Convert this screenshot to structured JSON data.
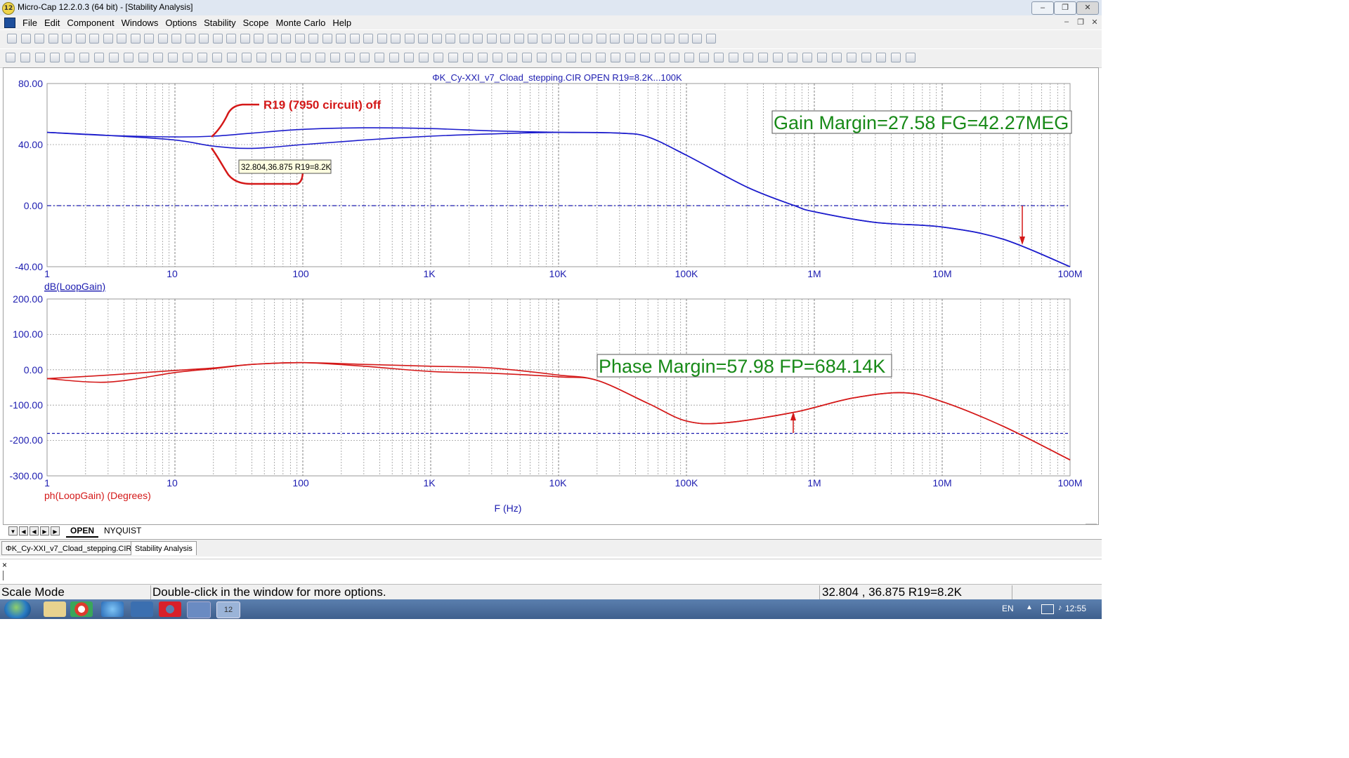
{
  "window": {
    "title": "Micro-Cap 12.2.0.3 (64 bit) - [Stability Analysis]",
    "app_icon": "12"
  },
  "menu": [
    "File",
    "Edit",
    "Component",
    "Windows",
    "Options",
    "Stability",
    "Scope",
    "Monte Carlo",
    "Help"
  ],
  "plot": {
    "title": "ΦK_Cy-XXI_v7_Cload_stepping.CIR OPEN R19=8.2K...100K",
    "xlabel": "F (Hz)",
    "x_ticks": [
      "1",
      "10",
      "100",
      "1K",
      "10K",
      "100K",
      "1M",
      "10M",
      "100M"
    ],
    "top": {
      "ylabel": "dB(LoopGain)",
      "y_ticks": [
        "80.00",
        "40.00",
        "0.00",
        "-40.00"
      ],
      "annotation": "Gain Margin=27.58 FG=42.27MEG",
      "handwritten": "R19 (7950 circuit) off",
      "tooltip": "32.804,36.875 R19=8.2K"
    },
    "bottom": {
      "ylabel": "ph(LoopGain) (Degrees)",
      "y_ticks": [
        "200.00",
        "100.00",
        "0.00",
        "-100.00",
        "-200.00",
        "-300.00"
      ],
      "annotation": "Phase Margin=57.98 FP=684.14K"
    }
  },
  "chart_data": [
    {
      "type": "line",
      "title": "ΦK_Cy-XXI_v7_Cload_stepping.CIR OPEN R19=8.2K...100K",
      "xlabel": "F (Hz)",
      "ylabel": "dB(LoopGain)",
      "xscale": "log",
      "xlim": [
        1,
        100000000
      ],
      "ylim": [
        -40,
        80
      ],
      "grid": true,
      "color": "#1c1ccc",
      "x": [
        1,
        3,
        10,
        20,
        40,
        100,
        300,
        1000,
        3000,
        10000,
        30000,
        50000,
        100000,
        300000,
        700000,
        1000000,
        3000000,
        10000000,
        30000000,
        100000000
      ],
      "series": [
        {
          "values": [
            48,
            46,
            43,
            39,
            37.5,
            40,
            43,
            45.5,
            47,
            48,
            47.5,
            45,
            33,
            12,
            0,
            -4,
            -11,
            -14,
            -22,
            -40
          ]
        },
        {
          "values": [
            48,
            46,
            45,
            45.5,
            47.5,
            50,
            51,
            50.5,
            49,
            48,
            47.5,
            45,
            33,
            12,
            0,
            -4,
            -11,
            -14,
            -22,
            -40
          ]
        }
      ],
      "reference_line": 0
    },
    {
      "type": "line",
      "xlabel": "F (Hz)",
      "ylabel": "ph(LoopGain) (Degrees)",
      "xscale": "log",
      "xlim": [
        1,
        100000000
      ],
      "ylim": [
        -300,
        200
      ],
      "grid": true,
      "color": "#d41818",
      "x": [
        1,
        3,
        10,
        20,
        40,
        100,
        300,
        1000,
        3000,
        10000,
        20000,
        50000,
        100000,
        200000,
        700000,
        2000000,
        5000000,
        10000000,
        30000000,
        100000000
      ],
      "series": [
        {
          "values": [
            -25,
            -35,
            -8,
            3,
            15,
            20,
            15,
            10,
            5,
            -15,
            -30,
            -95,
            -145,
            -150,
            -120,
            -80,
            -65,
            -90,
            -160,
            -255
          ]
        },
        {
          "values": [
            -25,
            -15,
            -2,
            5,
            15,
            20,
            10,
            -5,
            -10,
            -20,
            -30,
            -95,
            -145,
            -150,
            -120,
            -80,
            -65,
            -90,
            -160,
            -255
          ]
        }
      ],
      "reference_line": -180
    }
  ],
  "tabs": {
    "open": "OPEN",
    "nyquist": "NYQUIST"
  },
  "doctabs": [
    "ΦK_Cy-XXI_v7_Cload_stepping.CIR",
    "Stability Analysis"
  ],
  "command": {
    "close": "×"
  },
  "status": {
    "mode": "Scale Mode",
    "hint": "Double-click in the window for more options.",
    "cursor": "32.804 , 36.875 R19=8.2K"
  },
  "taskbar": {
    "lang": "EN",
    "time": "12:55",
    "app_badge": "12"
  },
  "colors": {
    "gain_trace": "#1c1ccc",
    "phase_trace": "#d41818",
    "annotation_text": "#188a18",
    "axis_text": "#1c1cb0"
  }
}
